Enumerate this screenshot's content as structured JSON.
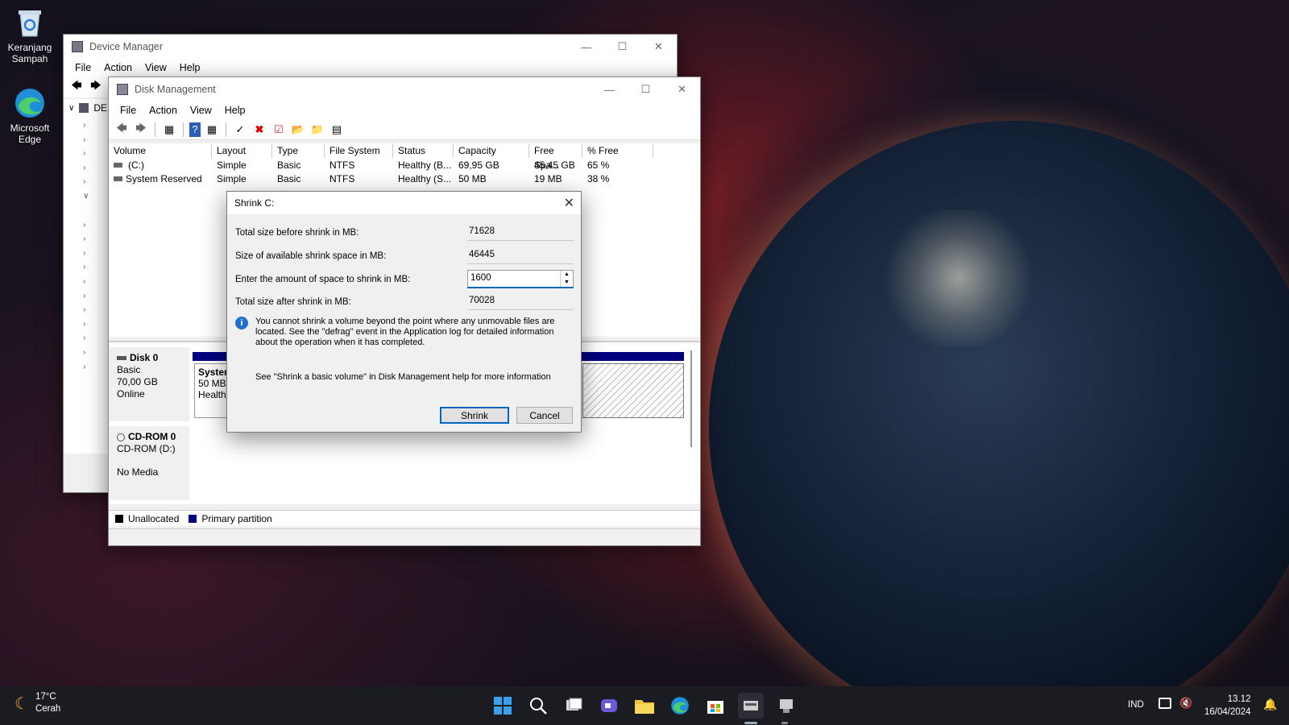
{
  "desktop": {
    "icons": [
      {
        "label": "Keranjang Sampah",
        "icon": "recycle-bin-icon"
      },
      {
        "label": "Microsoft Edge",
        "icon": "edge-icon"
      }
    ]
  },
  "device_manager": {
    "title": "Device Manager",
    "menu": [
      "File",
      "Action",
      "View",
      "Help"
    ],
    "tree_root": "DE"
  },
  "disk_management": {
    "title": "Disk Management",
    "menu": [
      "File",
      "Action",
      "View",
      "Help"
    ],
    "columns": [
      "Volume",
      "Layout",
      "Type",
      "File System",
      "Status",
      "Capacity",
      "Free Spa...",
      "% Free"
    ],
    "rows": [
      [
        "(C:)",
        "Simple",
        "Basic",
        "NTFS",
        "Healthy (B...",
        "69,95 GB",
        "45,45 GB",
        "65 %"
      ],
      [
        "System Reserved",
        "Simple",
        "Basic",
        "NTFS",
        "Healthy (S...",
        "50 MB",
        "19 MB",
        "38 %"
      ]
    ],
    "disk0": {
      "name": "Disk 0",
      "type": "Basic",
      "size": "70,00 GB",
      "status": "Online",
      "part_name": "System",
      "part_size": "50 MB",
      "part_status": "Healthy"
    },
    "cdrom": {
      "name": "CD-ROM 0",
      "drive": "CD-ROM (D:)",
      "media": "No Media"
    },
    "legend": {
      "unallocated": "Unallocated",
      "primary": "Primary partition",
      "unallocated_color": "#000000",
      "primary_color": "#000080"
    }
  },
  "dialog": {
    "title": "Shrink C:",
    "label_total": "Total size before shrink in MB:",
    "value_total": "71628",
    "label_available": "Size of available shrink space in MB:",
    "value_available": "46445",
    "label_amount": "Enter the amount of space to shrink in MB:",
    "value_amount": "1600",
    "label_after": "Total size after shrink in MB:",
    "value_after": "70028",
    "info": "You cannot shrink a volume beyond the point where any unmovable files are located. See the \"defrag\" event in the Application log for detailed information about the operation when it has completed.",
    "help": "See \"Shrink a basic volume\" in Disk Management help for more information",
    "shrink_label": "Shrink",
    "cancel_label": "Cancel"
  },
  "taskbar": {
    "temp": "17°C",
    "weather": "Cerah",
    "lang": "IND",
    "time": "13.12",
    "date": "16/04/2024"
  }
}
